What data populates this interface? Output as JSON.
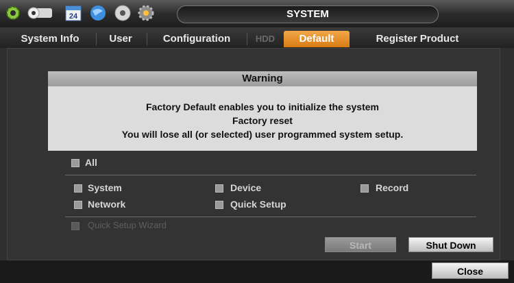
{
  "topbar": {
    "title": "SYSTEM",
    "calendar_day": "24",
    "icons": [
      "gear-icon",
      "camera-icon",
      "calendar-icon",
      "network-icon",
      "disc-icon",
      "settings-gear-icon"
    ]
  },
  "tabs": [
    {
      "label": "System Info",
      "state": "normal"
    },
    {
      "label": "User",
      "state": "normal"
    },
    {
      "label": "Configuration",
      "state": "normal"
    },
    {
      "label": "HDD",
      "state": "disabled"
    },
    {
      "label": "Default",
      "state": "active"
    },
    {
      "label": "Register Product",
      "state": "normal"
    }
  ],
  "warning": {
    "title": "Warning",
    "lines": [
      "Factory Default enables you to initialize the system",
      "Factory reset",
      "You will lose all (or selected) user programmed system setup."
    ]
  },
  "options": {
    "all": "All",
    "system": "System",
    "device": "Device",
    "record": "Record",
    "network": "Network",
    "quick_setup": "Quick Setup",
    "disabled_option": "Quick Setup Wizard"
  },
  "buttons": {
    "start": "Start",
    "shutdown": "Shut Down",
    "close": "Close"
  },
  "colors": {
    "active_tab": "#e88f22",
    "background": "#2f2f2f"
  }
}
